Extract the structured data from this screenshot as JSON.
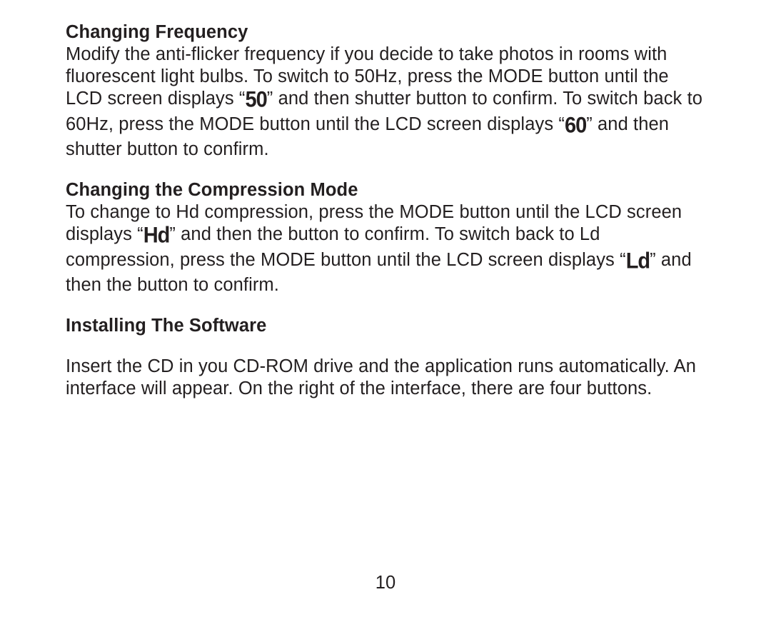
{
  "headings": {
    "frequency": "Changing Frequency",
    "compression": "Changing the Compression Mode",
    "installing": "Installing The Software"
  },
  "lcd": {
    "fifty": "50",
    "sixty": "60",
    "hd": "Hd",
    "ld": "Ld"
  },
  "text": {
    "freq_a": "Modify the anti-flicker frequency if you decide to take photos in rooms with fluorescent light bulbs.  To switch to 50Hz, press the MODE button until the LCD screen displays “",
    "freq_b": "” and then shutter button to confirm.  To switch back to 60Hz, press the MODE button until the LCD screen displays “",
    "freq_c": "” and then shutter button to confirm.",
    "comp_a": "To change to Hd compression, press the MODE button until the LCD screen displays  “",
    "comp_b": "”  and then the button to confirm.  To switch back to Ld compression, press the MODE button until the LCD screen displays  “",
    "comp_c": "”  and then the button to confirm.",
    "install": "Insert the CD in you CD-ROM drive and the application runs automatically.  An interface will appear.  On the right of the interface, there are four buttons."
  },
  "page_number": "10"
}
